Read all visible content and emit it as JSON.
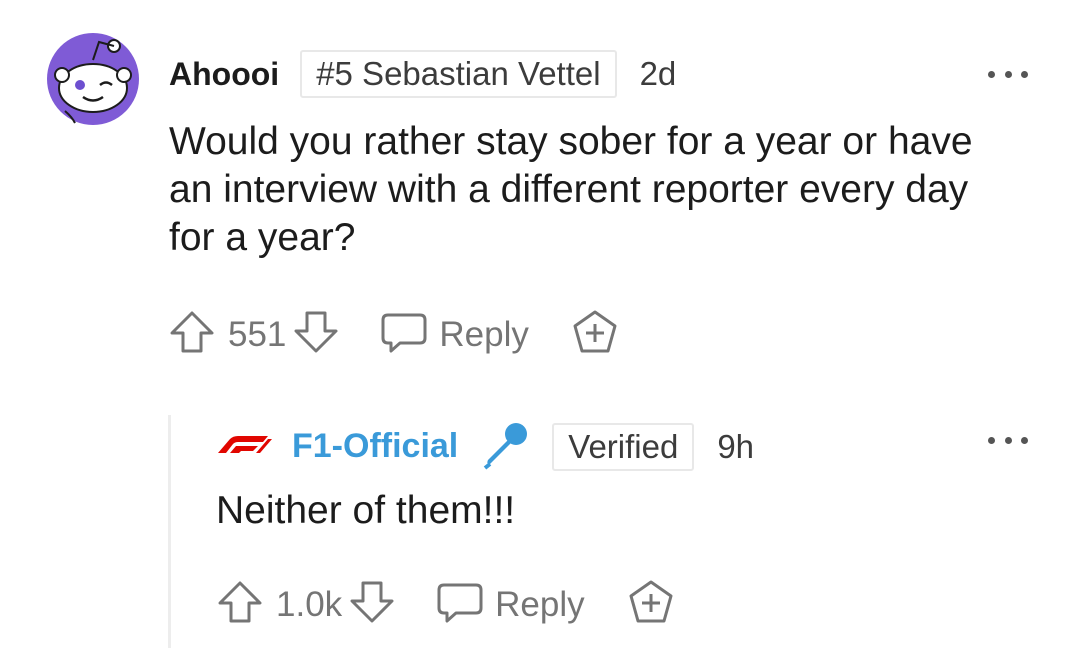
{
  "parent": {
    "username": "Ahoooi",
    "flair": "#5 Sebastian Vettel",
    "time": "2d",
    "body": [
      "Would you rather stay sober for a year or have",
      "an interview with a different reporter every day",
      "for a year?"
    ],
    "score": "551",
    "reply_label": "Reply"
  },
  "reply": {
    "username": "F1-Official",
    "badge": "Verified",
    "time": "9h",
    "body": "Neither of them!!!",
    "score": "1.0k",
    "reply_label": "Reply"
  },
  "colors": {
    "avatar_purple": "#7f5bd6",
    "f1_red": "#e10600",
    "link_blue": "#3a9ad9",
    "icon_gray": "#757575"
  }
}
